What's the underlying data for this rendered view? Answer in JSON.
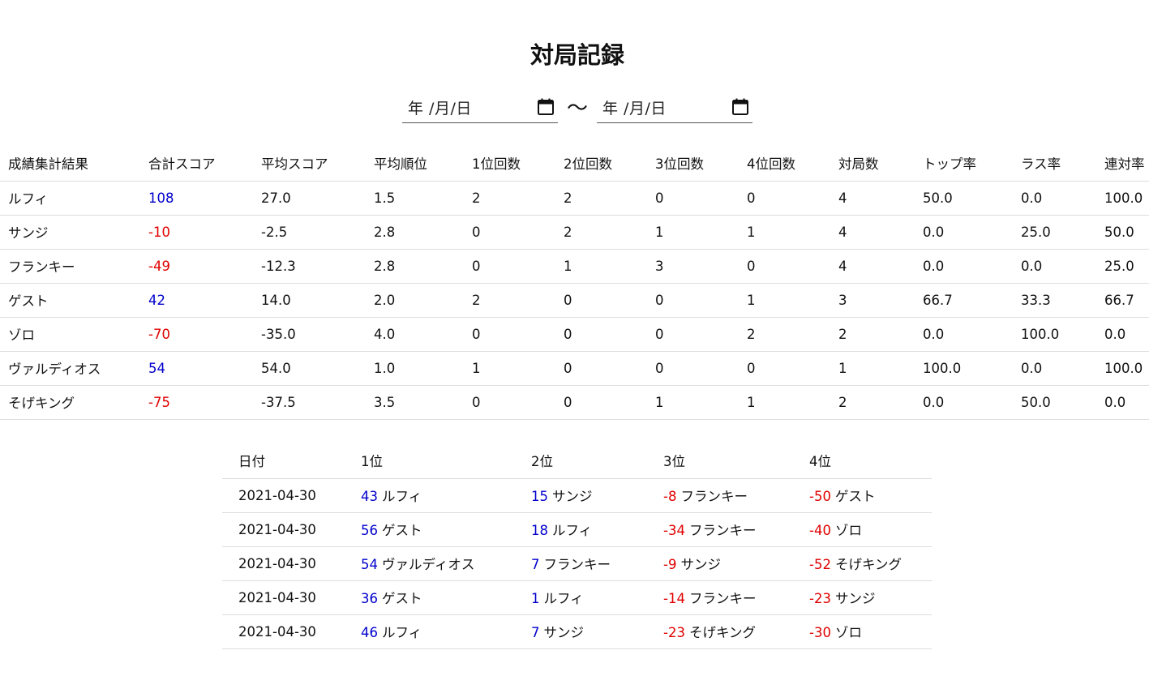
{
  "page_title": "対局記録",
  "date_filter": {
    "start_placeholder": "年 /月/日",
    "end_placeholder": "年 /月/日",
    "separator": "～"
  },
  "stats_table": {
    "headers": [
      "成績集計結果",
      "合計スコア",
      "平均スコア",
      "平均順位",
      "1位回数",
      "2位回数",
      "3位回数",
      "4位回数",
      "対局数",
      "トップ率",
      "ラス率",
      "連対率"
    ],
    "rows": [
      [
        "ルフィ",
        "108",
        "27.0",
        "1.5",
        "2",
        "2",
        "0",
        "0",
        "4",
        "50.0",
        "0.0",
        "100.0"
      ],
      [
        "サンジ",
        "-10",
        "-2.5",
        "2.8",
        "0",
        "2",
        "1",
        "1",
        "4",
        "0.0",
        "25.0",
        "50.0"
      ],
      [
        "フランキー",
        "-49",
        "-12.3",
        "2.8",
        "0",
        "1",
        "3",
        "0",
        "4",
        "0.0",
        "0.0",
        "25.0"
      ],
      [
        "ゲスト",
        "42",
        "14.0",
        "2.0",
        "2",
        "0",
        "0",
        "1",
        "3",
        "66.7",
        "33.3",
        "66.7"
      ],
      [
        "ゾロ",
        "-70",
        "-35.0",
        "4.0",
        "0",
        "0",
        "0",
        "2",
        "2",
        "0.0",
        "100.0",
        "0.0"
      ],
      [
        "ヴァルディオス",
        "54",
        "54.0",
        "1.0",
        "1",
        "0",
        "0",
        "0",
        "1",
        "100.0",
        "0.0",
        "100.0"
      ],
      [
        "そげキング",
        "-75",
        "-37.5",
        "3.5",
        "0",
        "0",
        "1",
        "1",
        "2",
        "0.0",
        "50.0",
        "0.0"
      ]
    ]
  },
  "games_table": {
    "headers": [
      "日付",
      "1位",
      "2位",
      "3位",
      "4位"
    ],
    "rows": [
      {
        "date": "2021-04-30",
        "results": [
          {
            "score": "43",
            "name": "ルフィ"
          },
          {
            "score": "15",
            "name": "サンジ"
          },
          {
            "score": "-8",
            "name": "フランキー"
          },
          {
            "score": "-50",
            "name": "ゲスト"
          }
        ]
      },
      {
        "date": "2021-04-30",
        "results": [
          {
            "score": "56",
            "name": "ゲスト"
          },
          {
            "score": "18",
            "name": "ルフィ"
          },
          {
            "score": "-34",
            "name": "フランキー"
          },
          {
            "score": "-40",
            "name": "ゾロ"
          }
        ]
      },
      {
        "date": "2021-04-30",
        "results": [
          {
            "score": "54",
            "name": "ヴァルディオス"
          },
          {
            "score": "7",
            "name": "フランキー"
          },
          {
            "score": "-9",
            "name": "サンジ"
          },
          {
            "score": "-52",
            "name": "そげキング"
          }
        ]
      },
      {
        "date": "2021-04-30",
        "results": [
          {
            "score": "36",
            "name": "ゲスト"
          },
          {
            "score": "1",
            "name": "ルフィ"
          },
          {
            "score": "-14",
            "name": "フランキー"
          },
          {
            "score": "-23",
            "name": "サンジ"
          }
        ]
      },
      {
        "date": "2021-04-30",
        "results": [
          {
            "score": "46",
            "name": "ルフィ"
          },
          {
            "score": "7",
            "name": "サンジ"
          },
          {
            "score": "-23",
            "name": "そげキング"
          },
          {
            "score": "-30",
            "name": "ゾロ"
          }
        ]
      }
    ]
  },
  "colors": {
    "positive": "#0000cc",
    "negative": "#e00000"
  }
}
